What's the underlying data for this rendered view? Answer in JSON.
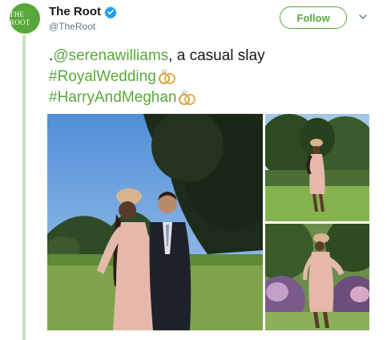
{
  "account": {
    "avatar_text": "THE ROOT",
    "display_name": "The Root",
    "handle": "@TheRoot",
    "verified": true
  },
  "actions": {
    "follow_label": "Follow",
    "menu_icon": "chevron-down-icon"
  },
  "tweet": {
    "prefix": ".",
    "mention": "@serenawilliams",
    "text_after_mention": ", a casual slay",
    "hashtag_1": "#RoyalWedding",
    "hashtag_2": "#HarryAndMeghan",
    "emoji_icon": "rings-icon"
  },
  "colors": {
    "accent": "#59a83a",
    "quote_bar": "#c9e3bf",
    "text": "#14171a",
    "muted": "#657786",
    "verified": "#1da1f2"
  }
}
